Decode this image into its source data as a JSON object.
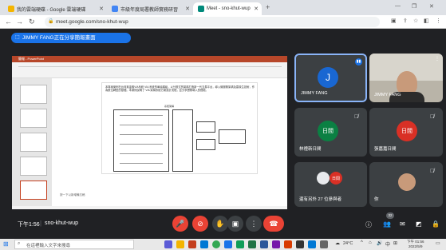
{
  "tabs": [
    {
      "label": "我的雲端硬碟 - Google 雲端硬碟",
      "favicon_color": "#f4b400",
      "active": false
    },
    {
      "label": "市級年度局署教師實務研習",
      "favicon_color": "#4285f4",
      "active": false
    },
    {
      "label": "Meet - sno-khut-wup",
      "favicon_color": "#00897b",
      "active": true
    }
  ],
  "address": {
    "url": "meet.google.com/sno-khut-wup"
  },
  "share_banner": {
    "text": "JIMMY FANG正在分享簡報畫面"
  },
  "presentation": {
    "app_title": "簡報 - PowerPoint",
    "slide_text": "本專案案例在台灣某金融VIA系統 VIA 系統的單據模組，以分散式的架構打造新一代交易平台，導入微服務架構及雲原生技術，作為數位轉型的基礎。本案例說明了 VIA 架構系統方案設計流程，並分享實際導入的經驗。",
    "diagram_title": "系統架構",
    "note": "按一下以新增備忘稿"
  },
  "participants": [
    {
      "name": "JIMMY FANG",
      "initial": "J",
      "avatar_color": "#1967d2",
      "muted": false,
      "speaking": true
    },
    {
      "name": "JIMMY FANG",
      "type": "video",
      "muted": false
    },
    {
      "name": "林禮新日間",
      "initial": "日間",
      "avatar_color": "#0b8043",
      "muted": true
    },
    {
      "name": "張嘉嘉日間",
      "initial": "日間",
      "avatar_color": "#d93025",
      "muted": true
    },
    {
      "name": "還有另外 27 位參與者",
      "initial": "日間",
      "avatar_color": "#d93025",
      "muted": true
    },
    {
      "name": "你",
      "type": "self",
      "muted": true
    }
  ],
  "bottom": {
    "time": "下午1:56",
    "meeting_code": "sno-khut-wup",
    "participant_count": "32"
  },
  "taskbar": {
    "search_placeholder": "在這裡輸入文字來搜尋",
    "weather": "24°C",
    "ime": "中",
    "clock_time": "下午 01:56",
    "clock_date": "2022/5/9"
  }
}
